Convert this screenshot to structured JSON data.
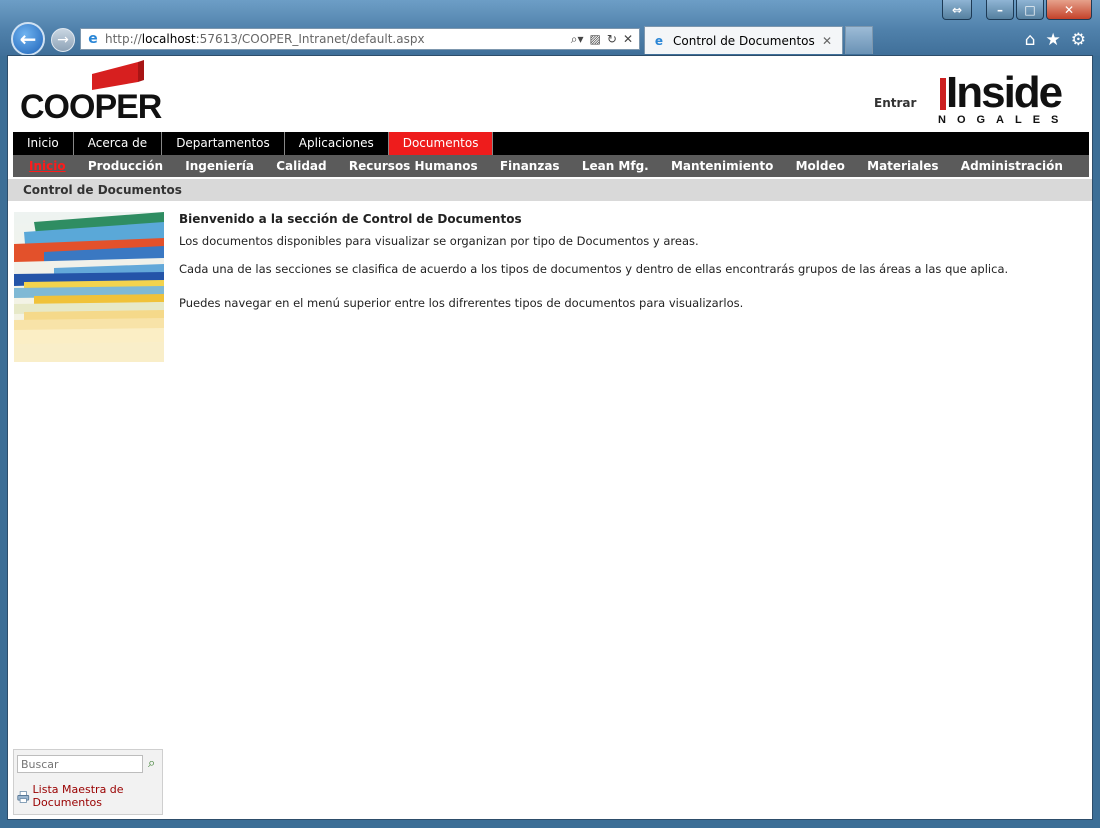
{
  "browser": {
    "url_prefix": "http://",
    "url_host": "localhost",
    "url_rest": ":57613/COOPER_Intranet/default.aspx",
    "tab_title": "Control de Documentos",
    "icons": [
      "back-arrow-icon",
      "forward-arrow-icon",
      "ie-logo-icon",
      "search-icon",
      "compatibility-icon",
      "refresh-icon",
      "stop-icon",
      "close-icon",
      "home-icon",
      "favorites-star-icon",
      "gear-icon"
    ]
  },
  "header": {
    "cooper_logo": "COOPER",
    "login_label": "Entrar",
    "inside_logo": "Inside",
    "inside_sub": "NOGALES"
  },
  "menu_main": {
    "items": [
      "Inicio",
      "Acerca de",
      "Departamentos",
      "Aplicaciones",
      "Documentos"
    ],
    "active": "Documentos"
  },
  "menu_sub": {
    "items": [
      "Inicio",
      "Producción",
      "Ingeniería",
      "Calidad",
      "Recursos Humanos",
      "Finanzas",
      "Lean Mfg.",
      "Mantenimiento",
      "Moldeo",
      "Materiales",
      "Administración"
    ],
    "active": "Inicio"
  },
  "breadcrumb": "Control de Documentos",
  "content": {
    "title": "Bienvenido a la sección de Control de Documentos",
    "p1": "Los documentos disponibles para visualizar se organizan por tipo de Documentos y areas.",
    "p2": "Cada una de las secciones se clasifica de acuerdo a los tipos de documentos y dentro de ellas encontrarás grupos de las áreas a las que aplica.",
    "p3": "Puedes navegar en el menú superior entre los difrerentes tipos de documentos para visualizarlos."
  },
  "sidebar": {
    "search_placeholder": "Buscar",
    "link_label": "Lista Maestra de Documentos"
  },
  "colors": {
    "brand_red": "#ee1c1c",
    "menu_black": "#000000",
    "submenu_gray": "#5b5b5b",
    "breadcrumb_gray": "#d9d9d9",
    "link_red": "#990000"
  }
}
